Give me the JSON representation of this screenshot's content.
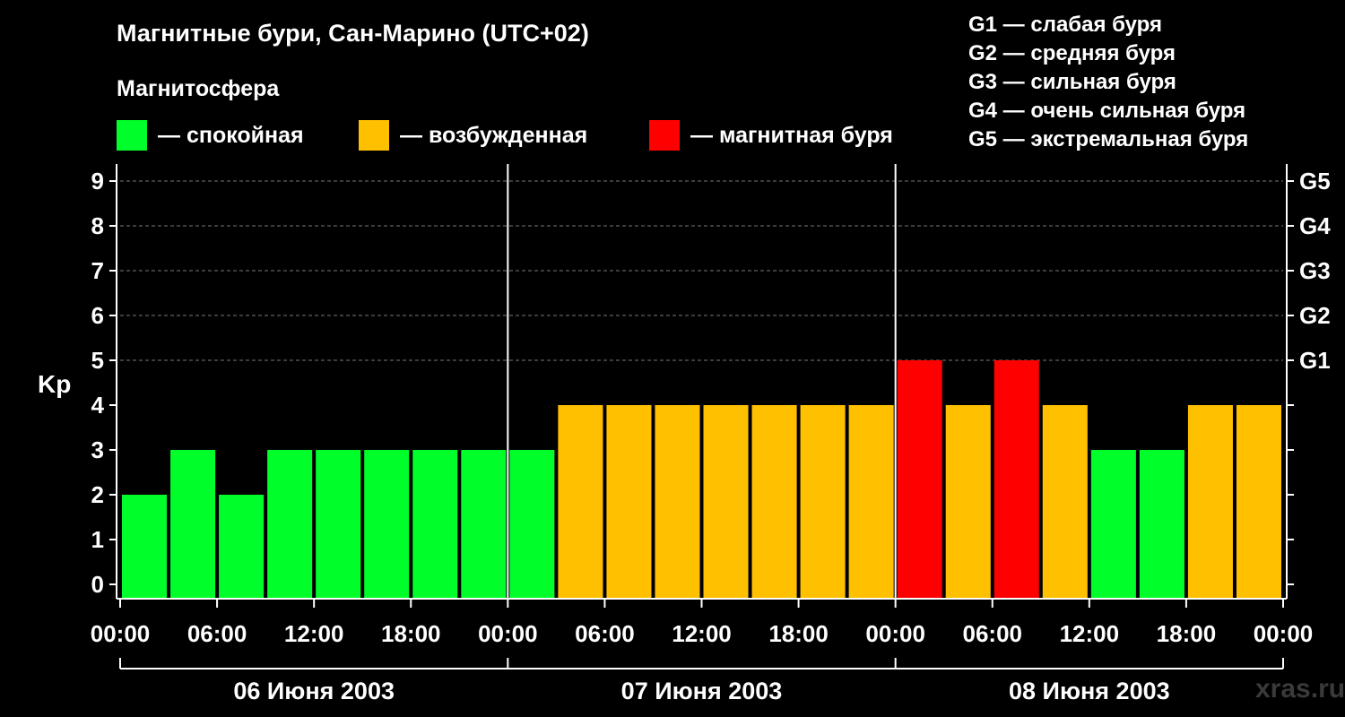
{
  "title": "Магнитные бури, Сан-Марино (UTC+02)",
  "subtitle": "Магнитосфера",
  "legend": [
    {
      "label": "— спокойная",
      "color": "#00ff2a"
    },
    {
      "label": "— возбужденная",
      "color": "#ffc000"
    },
    {
      "label": "— магнитная буря",
      "color": "#ff0000"
    }
  ],
  "g_legend": [
    "G1 — слабая буря",
    "G2 — средняя буря",
    "G3 — сильная буря",
    "G4 — очень сильная буря",
    "G5 — экстремальная буря"
  ],
  "watermark": "xras.ru",
  "chart_data": {
    "type": "bar",
    "ylabel": "Kp",
    "ylim": [
      0,
      9
    ],
    "yticks": [
      "0",
      "1",
      "2",
      "3",
      "4",
      "5",
      "6",
      "7",
      "8",
      "9"
    ],
    "right_ticks": [
      {
        "value": 5,
        "label": "G1"
      },
      {
        "value": 6,
        "label": "G2"
      },
      {
        "value": 7,
        "label": "G3"
      },
      {
        "value": 8,
        "label": "G4"
      },
      {
        "value": 9,
        "label": "G5"
      }
    ],
    "xtick_labels": [
      "00:00",
      "06:00",
      "12:00",
      "18:00",
      "00:00",
      "06:00",
      "12:00",
      "18:00",
      "00:00",
      "06:00",
      "12:00",
      "18:00",
      "00:00"
    ],
    "days": [
      "06 Июня 2003",
      "07 Июня 2003",
      "08 Июня 2003"
    ],
    "bar_start_hours": [
      0,
      3,
      6,
      9,
      12,
      15,
      18,
      21,
      24,
      27,
      30,
      33,
      36,
      39,
      42,
      45,
      48,
      51,
      54,
      57,
      60,
      63,
      66,
      69
    ],
    "values": [
      2,
      3,
      2,
      3,
      3,
      3,
      3,
      3,
      3,
      4,
      4,
      4,
      4,
      4,
      4,
      4,
      5,
      4,
      5,
      4,
      3,
      3,
      4,
      4
    ],
    "colors": {
      "quiet": "#00ff2a",
      "active": "#ffc000",
      "storm": "#ff0000"
    },
    "grid": true
  }
}
